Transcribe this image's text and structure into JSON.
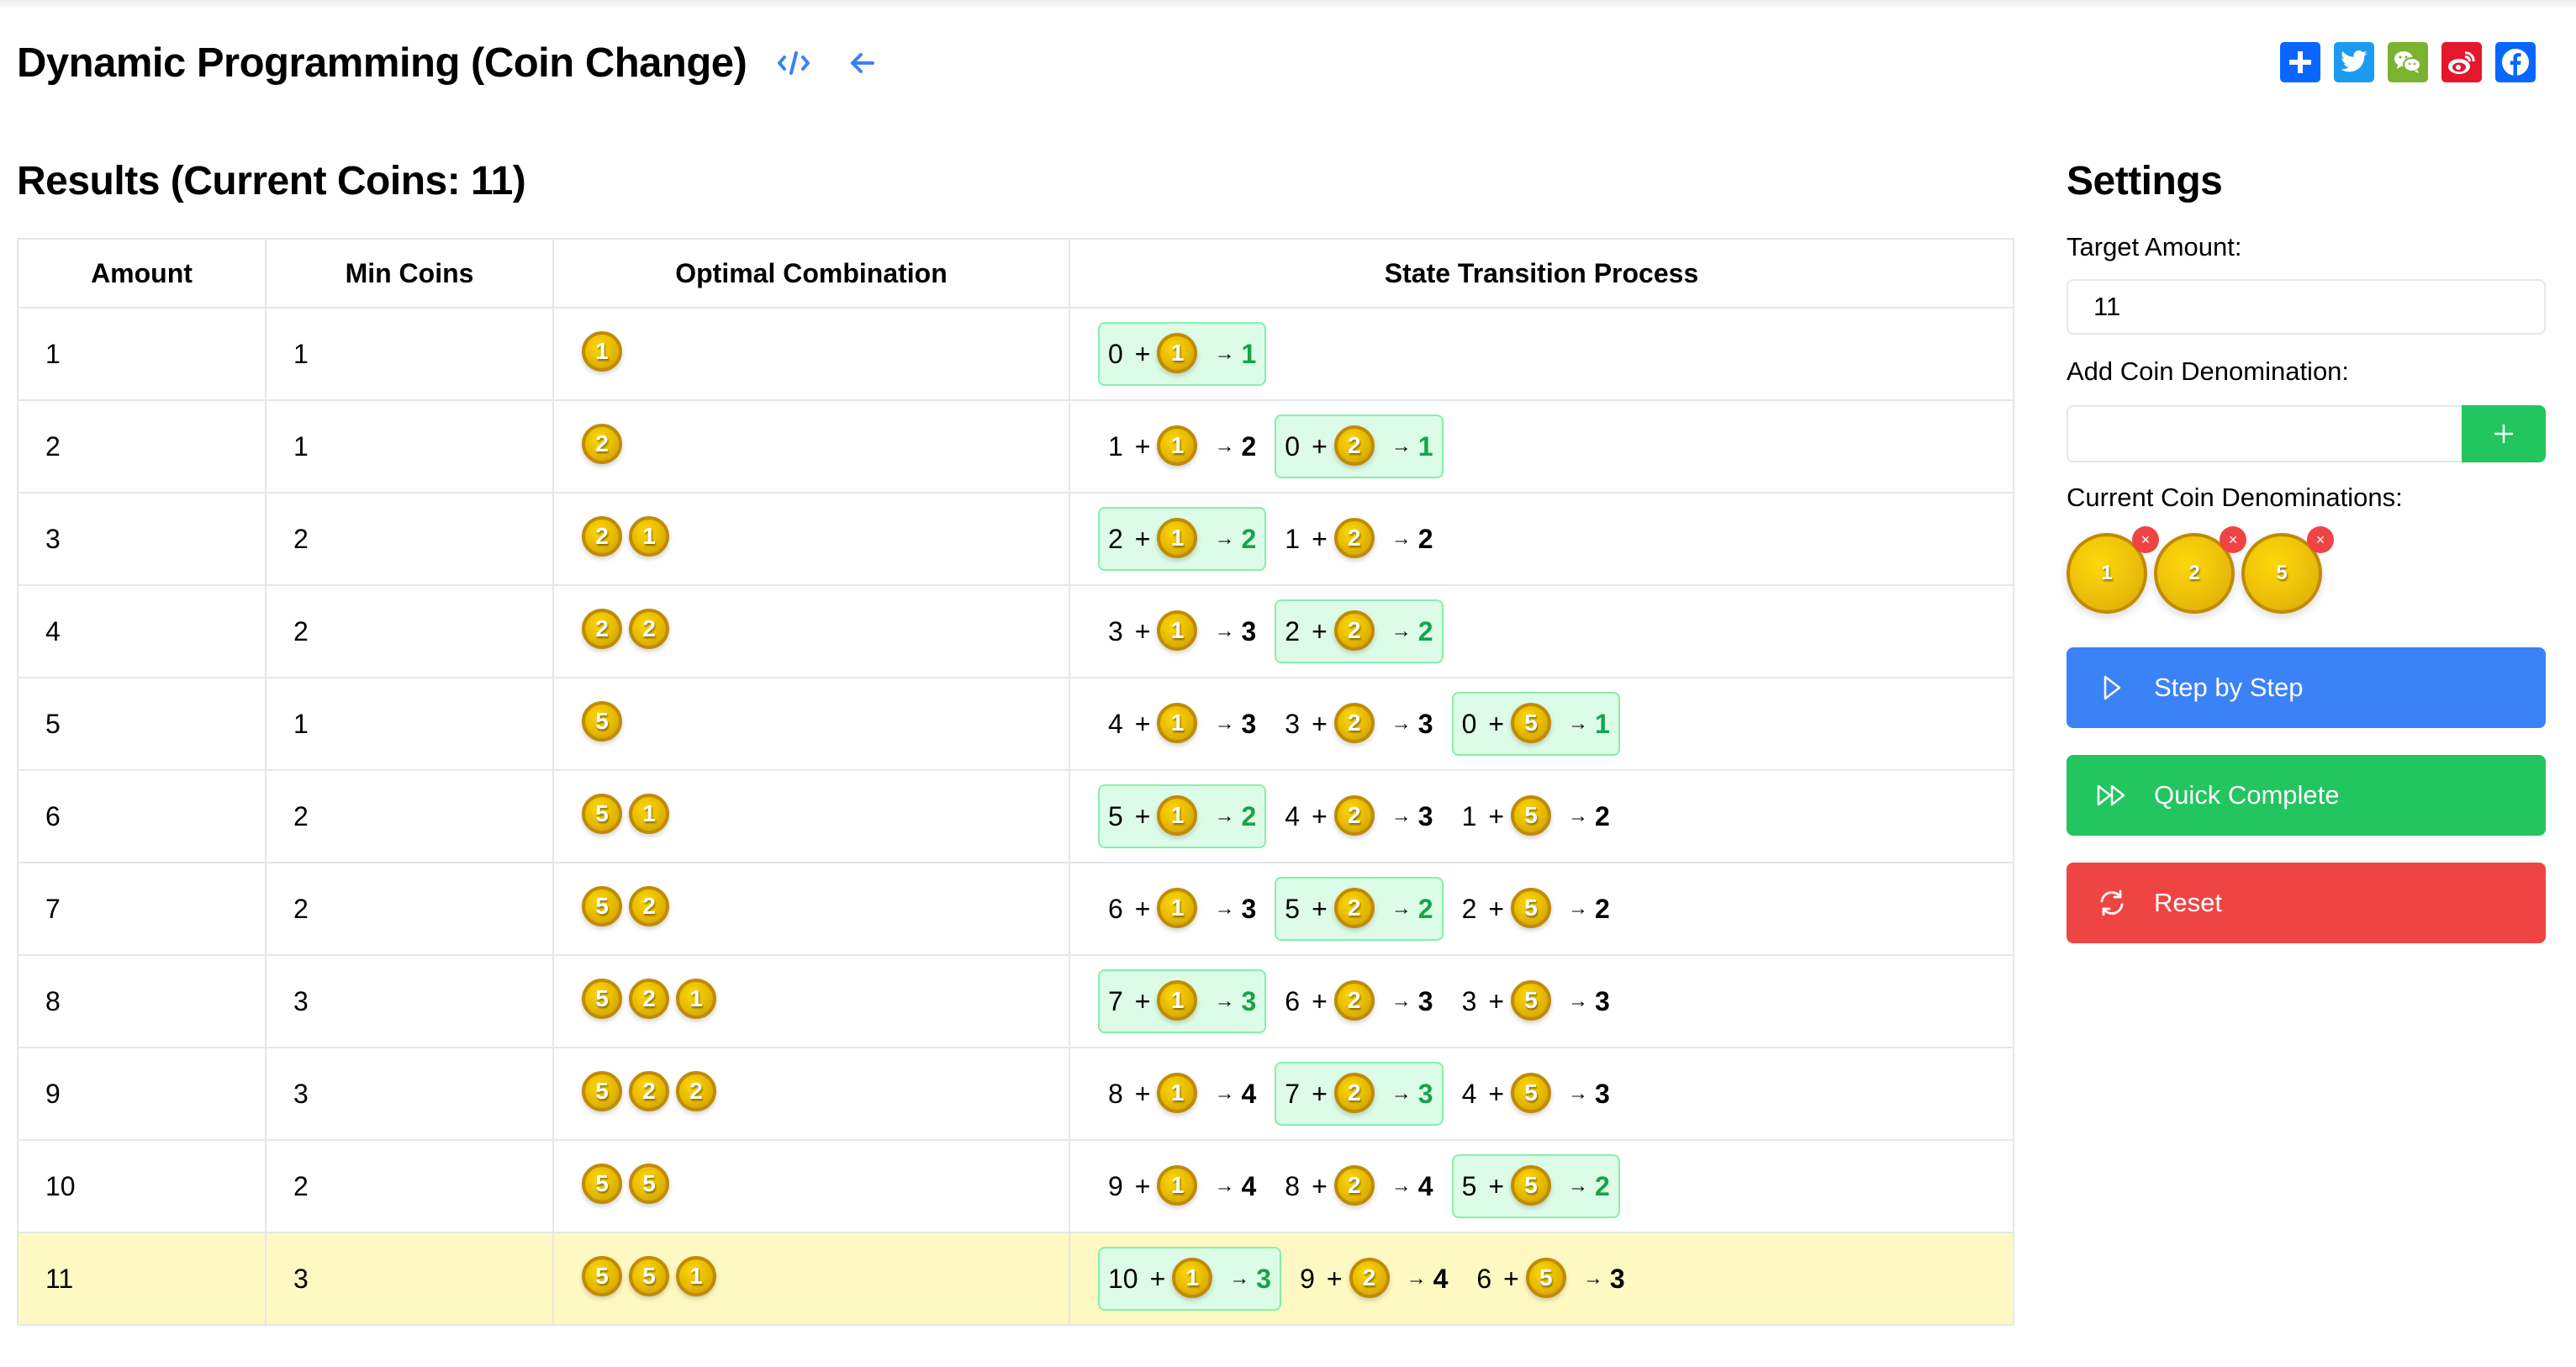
{
  "header": {
    "title": "Dynamic Programming (Coin Change)",
    "icons": [
      "code-icon",
      "arrow-left-icon"
    ],
    "share": [
      {
        "name": "share-add",
        "color": "#0866ff"
      },
      {
        "name": "twitter",
        "color": "#1d9bf0"
      },
      {
        "name": "wechat",
        "color": "#7bb32e"
      },
      {
        "name": "weibo",
        "color": "#e6162d"
      },
      {
        "name": "facebook",
        "color": "#0866ff"
      }
    ]
  },
  "results": {
    "title": "Results (Current Coins: 11)",
    "columns": [
      "Amount",
      "Min Coins",
      "Optimal Combination",
      "State Transition Process"
    ],
    "highlight_amount": "11",
    "rows": [
      {
        "amount": "1",
        "min": "1",
        "combo": [
          "1"
        ],
        "transitions": [
          {
            "from": "0",
            "coin": "1",
            "to": "1",
            "optimal": true
          }
        ]
      },
      {
        "amount": "2",
        "min": "1",
        "combo": [
          "2"
        ],
        "transitions": [
          {
            "from": "1",
            "coin": "1",
            "to": "2",
            "optimal": false
          },
          {
            "from": "0",
            "coin": "2",
            "to": "1",
            "optimal": true
          }
        ]
      },
      {
        "amount": "3",
        "min": "2",
        "combo": [
          "2",
          "1"
        ],
        "transitions": [
          {
            "from": "2",
            "coin": "1",
            "to": "2",
            "optimal": true
          },
          {
            "from": "1",
            "coin": "2",
            "to": "2",
            "optimal": false
          }
        ]
      },
      {
        "amount": "4",
        "min": "2",
        "combo": [
          "2",
          "2"
        ],
        "transitions": [
          {
            "from": "3",
            "coin": "1",
            "to": "3",
            "optimal": false
          },
          {
            "from": "2",
            "coin": "2",
            "to": "2",
            "optimal": true
          }
        ]
      },
      {
        "amount": "5",
        "min": "1",
        "combo": [
          "5"
        ],
        "transitions": [
          {
            "from": "4",
            "coin": "1",
            "to": "3",
            "optimal": false
          },
          {
            "from": "3",
            "coin": "2",
            "to": "3",
            "optimal": false
          },
          {
            "from": "0",
            "coin": "5",
            "to": "1",
            "optimal": true
          }
        ]
      },
      {
        "amount": "6",
        "min": "2",
        "combo": [
          "5",
          "1"
        ],
        "transitions": [
          {
            "from": "5",
            "coin": "1",
            "to": "2",
            "optimal": true
          },
          {
            "from": "4",
            "coin": "2",
            "to": "3",
            "optimal": false
          },
          {
            "from": "1",
            "coin": "5",
            "to": "2",
            "optimal": false
          }
        ]
      },
      {
        "amount": "7",
        "min": "2",
        "combo": [
          "5",
          "2"
        ],
        "transitions": [
          {
            "from": "6",
            "coin": "1",
            "to": "3",
            "optimal": false
          },
          {
            "from": "5",
            "coin": "2",
            "to": "2",
            "optimal": true
          },
          {
            "from": "2",
            "coin": "5",
            "to": "2",
            "optimal": false
          }
        ]
      },
      {
        "amount": "8",
        "min": "3",
        "combo": [
          "5",
          "2",
          "1"
        ],
        "transitions": [
          {
            "from": "7",
            "coin": "1",
            "to": "3",
            "optimal": true
          },
          {
            "from": "6",
            "coin": "2",
            "to": "3",
            "optimal": false
          },
          {
            "from": "3",
            "coin": "5",
            "to": "3",
            "optimal": false
          }
        ]
      },
      {
        "amount": "9",
        "min": "3",
        "combo": [
          "5",
          "2",
          "2"
        ],
        "transitions": [
          {
            "from": "8",
            "coin": "1",
            "to": "4",
            "optimal": false
          },
          {
            "from": "7",
            "coin": "2",
            "to": "3",
            "optimal": true
          },
          {
            "from": "4",
            "coin": "5",
            "to": "3",
            "optimal": false
          }
        ]
      },
      {
        "amount": "10",
        "min": "2",
        "combo": [
          "5",
          "5"
        ],
        "transitions": [
          {
            "from": "9",
            "coin": "1",
            "to": "4",
            "optimal": false
          },
          {
            "from": "8",
            "coin": "2",
            "to": "4",
            "optimal": false
          },
          {
            "from": "5",
            "coin": "5",
            "to": "2",
            "optimal": true
          }
        ]
      },
      {
        "amount": "11",
        "min": "3",
        "combo": [
          "5",
          "5",
          "1"
        ],
        "transitions": [
          {
            "from": "10",
            "coin": "1",
            "to": "3",
            "optimal": true
          },
          {
            "from": "9",
            "coin": "2",
            "to": "4",
            "optimal": false
          },
          {
            "from": "6",
            "coin": "5",
            "to": "3",
            "optimal": false
          }
        ]
      }
    ]
  },
  "settings": {
    "title": "Settings",
    "target_label": "Target Amount:",
    "target_value": "11",
    "add_label": "Add Coin Denomination:",
    "add_value": "",
    "add_button": "+",
    "current_label": "Current Coin Denominations:",
    "denominations": [
      "1",
      "2",
      "5"
    ],
    "remove_symbol": "×",
    "buttons": {
      "step": "Step by Step",
      "quick": "Quick Complete",
      "reset": "Reset"
    }
  },
  "colors": {
    "accent_blue": "#3b82f6",
    "success_green": "#22c55e",
    "danger_red": "#ef4444",
    "optimal_bg": "#dcfce7",
    "optimal_border": "#86efac",
    "optimal_text": "#16a34a",
    "highlight_row": "#fef9c3",
    "coin_gold": "#e5b800"
  }
}
